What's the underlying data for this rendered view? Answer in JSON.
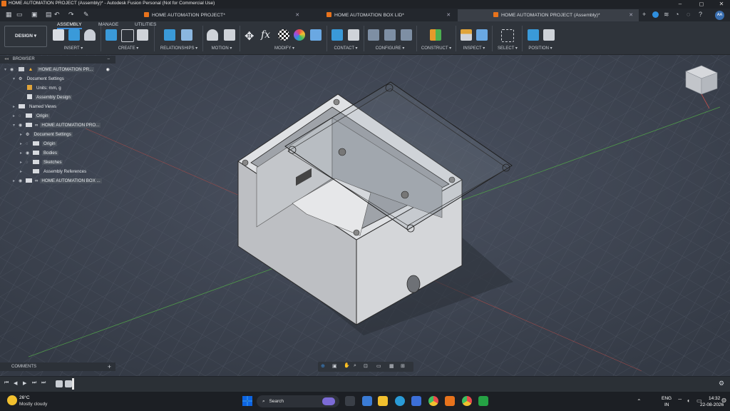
{
  "window": {
    "title": "HOME AUTOMATION PROJECT (Assembly)* - Autodesk Fusion Personal (Not for Commercial Use)",
    "controls": [
      "–",
      "◻",
      "✕"
    ]
  },
  "tabs": [
    {
      "label": "HOME AUTOMATION PROJECT*",
      "active": false
    },
    {
      "label": "HOME AUTOMATION BOX LID*",
      "active": false
    },
    {
      "label": "HOME AUTOMATION PROJECT (Assembly)*",
      "active": true
    }
  ],
  "tab_close": "✕",
  "user_initials": "AA",
  "workspace": {
    "label": "DESIGN ▾"
  },
  "ribbon_tabs": [
    "ASSEMBLY",
    "MANAGE",
    "UTILITIES"
  ],
  "ribbon_groups": [
    "INSERT ▾",
    "CREATE ▾",
    "RELATIONSHIPS ▾",
    "MOTION ▾",
    "MODIFY ▾",
    "CONTACT ▾",
    "CONFIGURE ▾",
    "CONSTRUCT ▾",
    "INSPECT ▾",
    "SELECT ▾",
    "POSITION ▾"
  ],
  "browser": {
    "header": "BROWSER",
    "rows": [
      {
        "label": "HOME AUTOMATION PR...",
        "indent": 0
      },
      {
        "label": "Document Settings",
        "indent": 1
      },
      {
        "label": "Units: mm, g",
        "indent": 2
      },
      {
        "label": "Assembly Design",
        "indent": 2
      },
      {
        "label": "Named Views",
        "indent": 1
      },
      {
        "label": "Origin",
        "indent": 1
      },
      {
        "label": "HOME AUTOMATION PRO...",
        "indent": 1
      },
      {
        "label": "Document Settings",
        "indent": 2
      },
      {
        "label": "Origin",
        "indent": 2
      },
      {
        "label": "Bodies",
        "indent": 2
      },
      {
        "label": "Sketches",
        "indent": 2
      },
      {
        "label": "Assembly References",
        "indent": 2
      },
      {
        "label": "HOME AUTOMATION BOX ...",
        "indent": 1
      }
    ]
  },
  "comments": {
    "label": "COMMENTS",
    "add": "+"
  },
  "taskbar": {
    "weather_temp": "26°C",
    "weather_desc": "Mostly cloudy",
    "search": "Search",
    "lang_top": "ENG",
    "lang_bottom": "IN",
    "time": "14:32",
    "date": "22-08-2026"
  },
  "colors": {
    "accent": "#3b8bd9",
    "model": "#c9cbcf",
    "fusion_orange": "#e8731c"
  }
}
